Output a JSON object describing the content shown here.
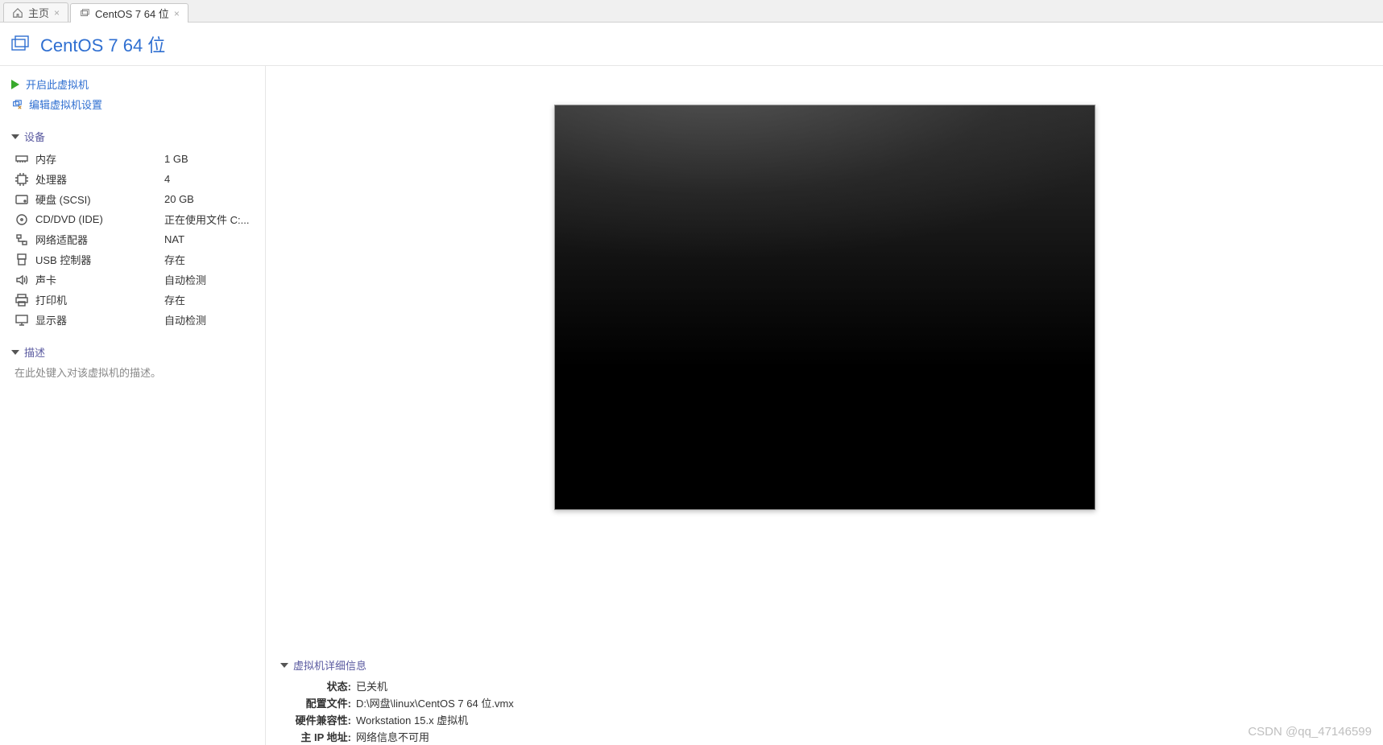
{
  "tabs": [
    {
      "label": "主页",
      "icon": "home",
      "active": false
    },
    {
      "label": "CentOS 7 64 位",
      "icon": "screens",
      "active": true
    }
  ],
  "title": "CentOS 7 64 位",
  "actions": {
    "power_on": "开启此虚拟机",
    "edit": "编辑虚拟机设置"
  },
  "sections": {
    "devices": "设备",
    "description": "描述",
    "details": "虚拟机详细信息"
  },
  "devices": [
    {
      "icon": "memory",
      "name": "内存",
      "value": "1 GB"
    },
    {
      "icon": "cpu",
      "name": "处理器",
      "value": "4"
    },
    {
      "icon": "disk",
      "name": "硬盘 (SCSI)",
      "value": "20 GB"
    },
    {
      "icon": "disc",
      "name": "CD/DVD (IDE)",
      "value": "正在使用文件 C:..."
    },
    {
      "icon": "net",
      "name": "网络适配器",
      "value": "NAT"
    },
    {
      "icon": "usb",
      "name": "USB 控制器",
      "value": "存在"
    },
    {
      "icon": "sound",
      "name": "声卡",
      "value": "自动检测"
    },
    {
      "icon": "printer",
      "name": "打印机",
      "value": "存在"
    },
    {
      "icon": "display",
      "name": "显示器",
      "value": "自动检测"
    }
  ],
  "description_placeholder": "在此处键入对该虚拟机的描述。",
  "details": [
    {
      "k": "状态:",
      "v": "已关机"
    },
    {
      "k": "配置文件:",
      "v": "D:\\网盘\\linux\\CentOS 7 64 位.vmx"
    },
    {
      "k": "硬件兼容性:",
      "v": "Workstation 15.x 虚拟机"
    },
    {
      "k": "主 IP 地址:",
      "v": "网络信息不可用"
    }
  ],
  "watermark": "CSDN @qq_47146599"
}
